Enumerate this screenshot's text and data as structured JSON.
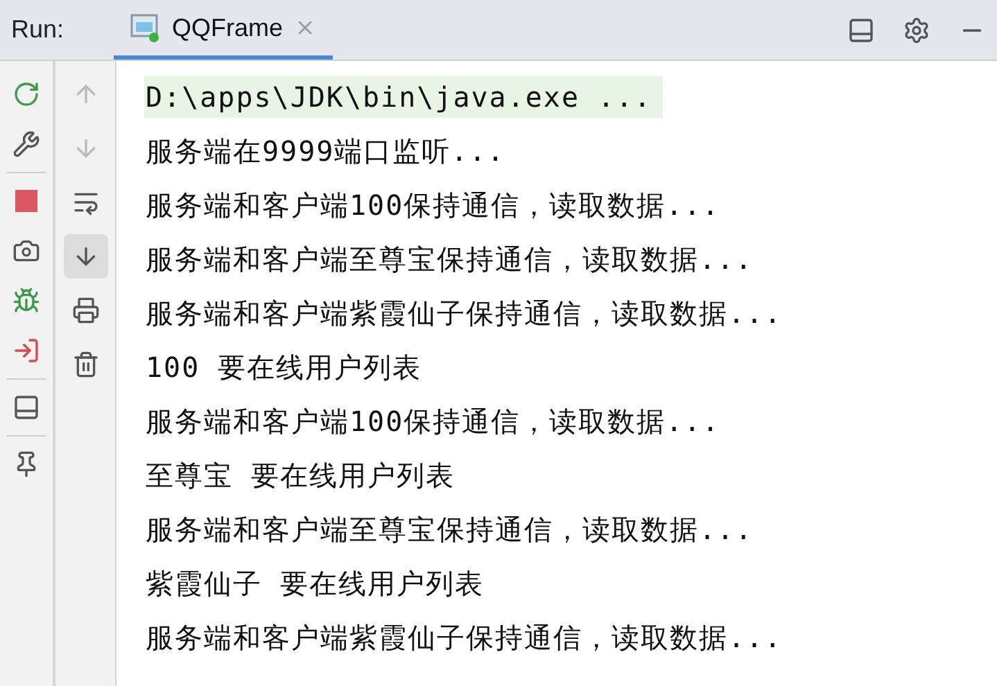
{
  "run_panel": {
    "label": "Run:",
    "tabs": [
      {
        "title": "QQFrame",
        "selected": true
      }
    ]
  },
  "console": {
    "lines": [
      {
        "text": "D:\\apps\\JDK\\bin\\java.exe ...",
        "kind": "command"
      },
      {
        "text": "服务端在9999端口监听...",
        "kind": "output"
      },
      {
        "text": "服务端和客户端100保持通信，读取数据...",
        "kind": "output"
      },
      {
        "text": "服务端和客户端至尊宝保持通信，读取数据...",
        "kind": "output"
      },
      {
        "text": "服务端和客户端紫霞仙子保持通信，读取数据...",
        "kind": "output"
      },
      {
        "text": "100 要在线用户列表",
        "kind": "output"
      },
      {
        "text": "服务端和客户端100保持通信，读取数据...",
        "kind": "output"
      },
      {
        "text": "至尊宝 要在线用户列表",
        "kind": "output"
      },
      {
        "text": "服务端和客户端至尊宝保持通信，读取数据...",
        "kind": "output"
      },
      {
        "text": "紫霞仙子 要在线用户列表",
        "kind": "output"
      },
      {
        "text": "服务端和客户端紫霞仙子保持通信，读取数据...",
        "kind": "output"
      }
    ]
  },
  "side_tools": [
    {
      "kind": "scroll-to-end",
      "selected": true
    }
  ]
}
